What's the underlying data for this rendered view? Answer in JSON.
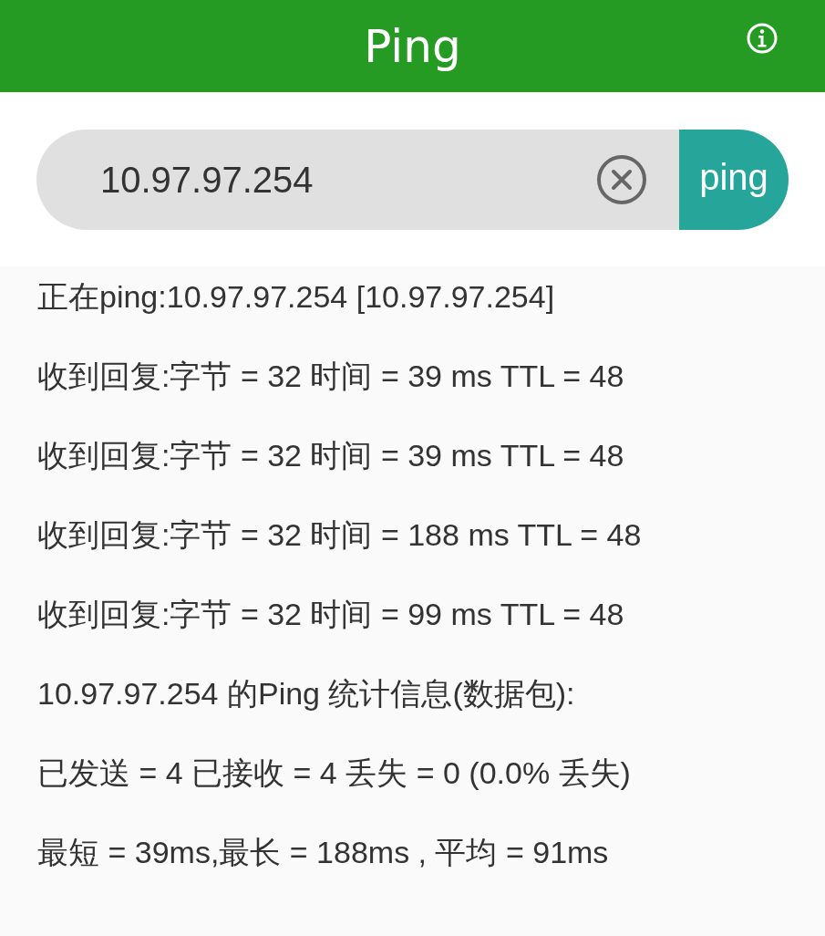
{
  "app_bar": {
    "title": "Ping"
  },
  "search": {
    "value": "10.97.97.254",
    "button": "ping"
  },
  "output_lines": [
    "正在ping:10.97.97.254 [10.97.97.254]",
    "收到回复:字节 = 32 时间 = 39 ms TTL = 48",
    "收到回复:字节 = 32 时间 = 39 ms TTL = 48",
    "收到回复:字节 = 32 时间 = 188 ms TTL = 48",
    "收到回复:字节 = 32 时间 = 99 ms TTL = 48",
    "10.97.97.254 的Ping 统计信息(数据包):",
    "已发送 = 4 已接收 = 4 丢失 = 0 (0.0% 丢失)",
    "最短 = 39ms,最长 = 188ms , 平均 = 91ms"
  ]
}
